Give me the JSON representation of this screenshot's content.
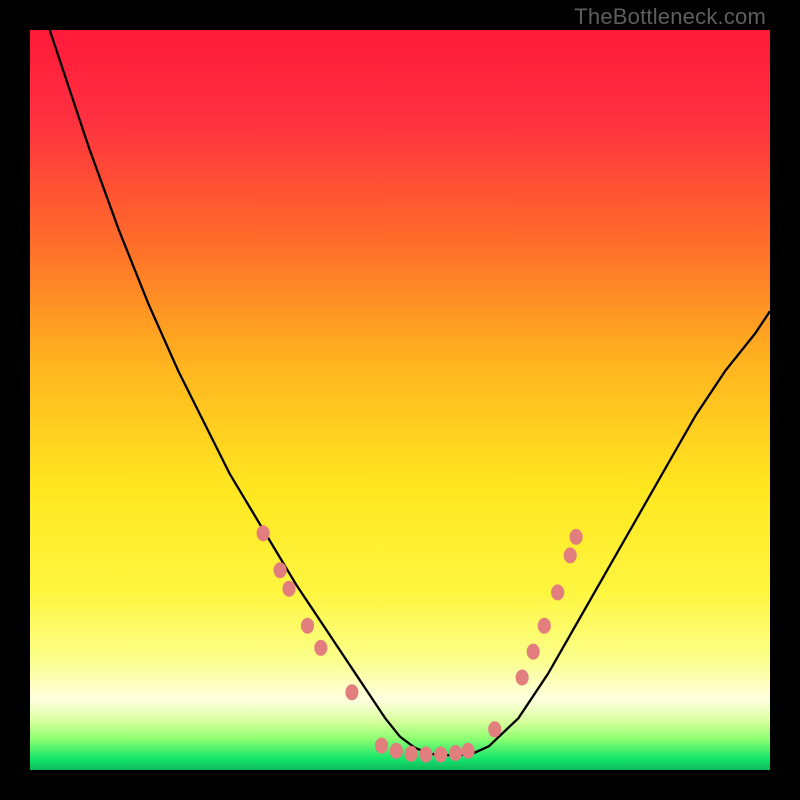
{
  "watermark": "TheBottleneck.com",
  "chart_data": {
    "type": "line",
    "title": "",
    "xlabel": "",
    "ylabel": "",
    "xlim": [
      0,
      100
    ],
    "ylim": [
      0,
      100
    ],
    "grid": false,
    "legend": false,
    "background_gradient_stops": [
      {
        "offset": 0.0,
        "color": "#ff1a3a"
      },
      {
        "offset": 0.12,
        "color": "#ff3040"
      },
      {
        "offset": 0.28,
        "color": "#ff6a2a"
      },
      {
        "offset": 0.45,
        "color": "#ffb41f"
      },
      {
        "offset": 0.62,
        "color": "#ffe720"
      },
      {
        "offset": 0.76,
        "color": "#fff640"
      },
      {
        "offset": 0.85,
        "color": "#fbff8a"
      },
      {
        "offset": 0.905,
        "color": "#ffffe0"
      },
      {
        "offset": 0.935,
        "color": "#d6ff9a"
      },
      {
        "offset": 0.958,
        "color": "#8cff70"
      },
      {
        "offset": 0.985,
        "color": "#14e56c"
      },
      {
        "offset": 1.0,
        "color": "#0fb85a"
      }
    ],
    "series": [
      {
        "name": "bottleneck-curve",
        "color": "#000000",
        "stroke_width": 2.3,
        "x": [
          0,
          4,
          8,
          12,
          16,
          20,
          24,
          27,
          30,
          33,
          36,
          38,
          40,
          42,
          44,
          46,
          48,
          50,
          52,
          54,
          56,
          58,
          60,
          62,
          66,
          70,
          74,
          78,
          82,
          86,
          90,
          94,
          98,
          100
        ],
        "y": [
          108,
          96,
          84,
          73,
          63,
          54,
          46,
          40,
          35,
          30,
          25,
          22,
          19,
          16,
          13,
          10,
          7,
          4.5,
          3,
          2.2,
          2,
          2,
          2.3,
          3.2,
          7,
          13,
          20,
          27,
          34,
          41,
          48,
          54,
          59,
          62
        ]
      }
    ],
    "markers": {
      "color": "#e37e7e",
      "radius": 8,
      "points": [
        {
          "x": 31.5,
          "y": 32
        },
        {
          "x": 33.8,
          "y": 27
        },
        {
          "x": 35.0,
          "y": 24.5
        },
        {
          "x": 37.5,
          "y": 19.5
        },
        {
          "x": 39.3,
          "y": 16.5
        },
        {
          "x": 43.5,
          "y": 10.5
        },
        {
          "x": 47.5,
          "y": 3.3
        },
        {
          "x": 49.5,
          "y": 2.6
        },
        {
          "x": 51.5,
          "y": 2.2
        },
        {
          "x": 53.5,
          "y": 2.1
        },
        {
          "x": 55.5,
          "y": 2.1
        },
        {
          "x": 57.5,
          "y": 2.3
        },
        {
          "x": 59.2,
          "y": 2.6
        },
        {
          "x": 62.8,
          "y": 5.5
        },
        {
          "x": 66.5,
          "y": 12.5
        },
        {
          "x": 68.0,
          "y": 16.0
        },
        {
          "x": 69.5,
          "y": 19.5
        },
        {
          "x": 71.3,
          "y": 24.0
        },
        {
          "x": 73.0,
          "y": 29.0
        },
        {
          "x": 73.8,
          "y": 31.5
        }
      ]
    }
  }
}
